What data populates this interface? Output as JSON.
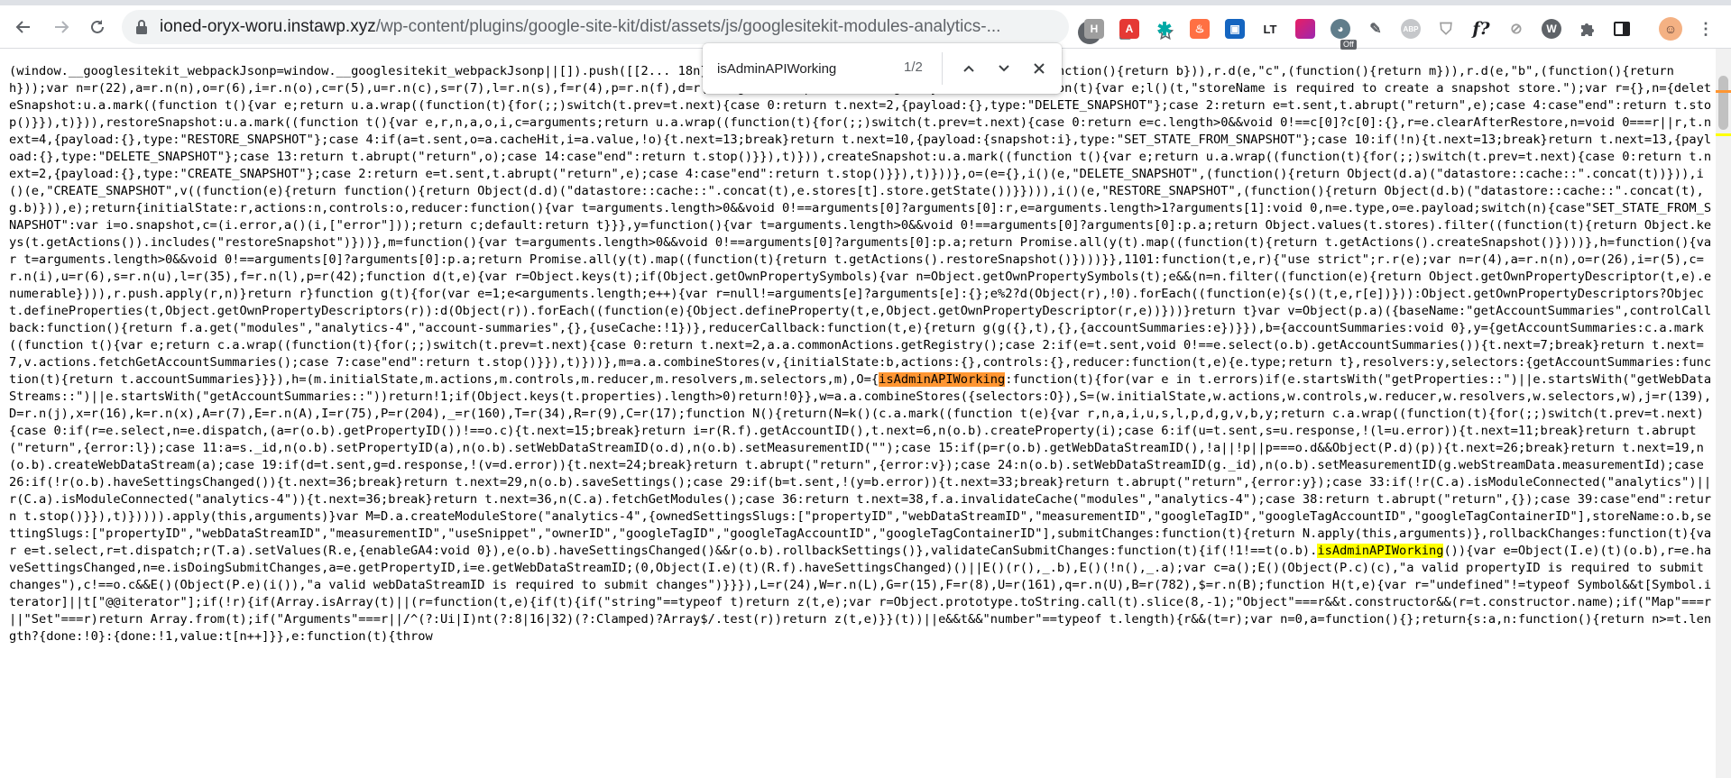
{
  "browser": {
    "url_host": "ioned-oryx-woru.instawp.xyz",
    "url_path": "/wp-content/plugins/google-site-kit/dist/assets/js/googlesitekit-modules-analytics-...",
    "extension_badge": "Off",
    "profile_letter": "W"
  },
  "find": {
    "query": "isAdminAPIWorking",
    "count": "1/2"
  },
  "code": {
    "part1": "(window.__googlesitekit_webpackJsonp=window.__googlesitekit_webpackJsonp||[]).push([[2... 18n},102:function(t,e,r){\"use strict\";r.d(e,\"a\",(function(){return b})),r.d(e,\"c\",(function(){return m})),r.d(e,\"b\",(function(){return h}));var n=r(22),a=r.n(n),o=r(6),i=r.n(o),c=r(5),u=r.n(c),s=r(7),l=r.n(s),f=r(4),p=r.n(f),d=r(47),g=r(8),v=p.a.createRegistryControl,b=function(t){var e;l()(t,\"storeName is required to create a snapshot store.\");var r={},n={deleteSnapshot:u.a.mark((function t(){var e;return u.a.wrap((function(t){for(;;)switch(t.prev=t.next){case 0:return t.next=2,{payload:{},type:\"DELETE_SNAPSHOT\"};case 2:return e=t.sent,t.abrupt(\"return\",e);case 4:case\"end\":return t.stop()}}),t)})),restoreSnapshot:u.a.mark((function t(){var e,r,n,a,o,i,c=arguments;return u.a.wrap((function(t){for(;;)switch(t.prev=t.next){case 0:return e=c.length>0&&void 0!==c[0]?c[0]:{},r=e.clearAfterRestore,n=void 0===r||r,t.next=4,{payload:{},type:\"RESTORE_SNAPSHOT\"};case 4:if(a=t.sent,o=a.cacheHit,i=a.value,!o){t.next=13;break}return t.next=10,{payload:{snapshot:i},type:\"SET_STATE_FROM_SNAPSHOT\"};case 10:if(!n){t.next=13;break}return t.next=13,{payload:{},type:\"DELETE_SNAPSHOT\"};case 13:return t.abrupt(\"return\",o);case 14:case\"end\":return t.stop()}}),t)})),createSnapshot:u.a.mark((function t(){var e;return u.a.wrap((function(t){for(;;)switch(t.prev=t.next){case 0:return t.next=2,{payload:{},type:\"CREATE_SNAPSHOT\"};case 2:return e=t.sent,t.abrupt(\"return\",e);case 4:case\"end\":return t.stop()}}),t)}))},o=(e={},i()(e,\"DELETE_SNAPSHOT\",(function(){return Object(d.a)(\"datastore::cache::\".concat(t))})),i()(e,\"CREATE_SNAPSHOT\",v((function(e){return function(){return Object(d.d)(\"datastore::cache::\".concat(t),e.stores[t].store.getState())}}))),i()(e,\"RESTORE_SNAPSHOT\",(function(){return Object(d.b)(\"datastore::cache::\".concat(t),g.b)})),e);return{initialState:r,actions:n,controls:o,reducer:function(){var t=arguments.length>0&&void 0!==arguments[0]?arguments[0]:r,e=arguments.length>1?arguments[1]:void 0,n=e.type,o=e.payload;switch(n){case\"SET_STATE_FROM_SNAPSHOT\":var i=o.snapshot,c=(i.error,a()(i,[\"error\"]));return c;default:return t}}},y=function(){var t=arguments.length>0&&void 0!==arguments[0]?arguments[0]:p.a;return Object.values(t.stores).filter((function(t){return Object.keys(t.getActions()).includes(\"restoreSnapshot\")}))},m=function(){var t=arguments.length>0&&void 0!==arguments[0]?arguments[0]:p.a;return Promise.all(y(t).map((function(t){return t.getActions().createSnapshot()})))},h=function(){var t=arguments.length>0&&void 0!==arguments[0]?arguments[0]:p.a;return Promise.all(y(t).map((function(t){return t.getActions().restoreSnapshot()})))}},1101:function(t,e,r){\"use strict\";r.r(e);var n=r(4),a=r.n(n),o=r(26),i=r(5),c=r.n(i),u=r(6),s=r.n(u),l=r(35),f=r.n(l),p=r(42);function d(t,e){var r=Object.keys(t);if(Object.getOwnPropertySymbols){var n=Object.getOwnPropertySymbols(t);e&&(n=n.filter((function(e){return Object.getOwnPropertyDescriptor(t,e).enumerable}))),r.push.apply(r,n)}return r}function g(t){for(var e=1;e<arguments.length;e++){var r=null!=arguments[e]?arguments[e]:{};e%2?d(Object(r),!0).forEach((function(e){s()(t,e,r[e])})):Object.getOwnPropertyDescriptors?Object.defineProperties(t,Object.getOwnPropertyDescriptors(r)):d(Object(r)).forEach((function(e){Object.defineProperty(t,e,Object.getOwnPropertyDescriptor(r,e))}))}return t}var v=Object(p.a)({baseName:\"getAccountSummaries\",controlCallback:function(){return f.a.get(\"modules\",\"analytics-4\",\"account-summaries\",{},{useCache:!1})},reducerCallback:function(t,e){return g(g({},t),{},{accountSummaries:e})}}),b={accountSummaries:void 0},y={getAccountSummaries:c.a.mark((function t(){var e;return c.a.wrap((function(t){for(;;)switch(t.prev=t.next){case 0:return t.next=2,a.a.commonActions.getRegistry();case 2:if(e=t.sent,void 0!==e.select(o.b).getAccountSummaries()){t.next=7;break}return t.next=7,v.actions.fetchGetAccountSummaries();case 7:case\"end\":return t.stop()}}),t)}))},m=a.a.combineStores(v,{initialState:b,actions:{},controls:{},reducer:function(t,e){e.type;return t},resolvers:y,selectors:{getAccountSummaries:function(t){return t.accountSummaries}}}),h=(m.initialState,m.actions,m.controls,m.reducer,m.resolvers,m.selectors,m),O={",
    "match1": "isAdminAPIWorking",
    "part2": ":function(t){for(var e in t.errors)if(e.startsWith(\"getProperties::\")||e.startsWith(\"getWebDataStreams::\")||e.startsWith(\"getAccountSummaries::\"))return!1;if(Object.keys(t.properties).length>0)return!0}},w=a.a.combineStores({selectors:O}),S=(w.initialState,w.actions,w.controls,w.reducer,w.resolvers,w.selectors,w),j=r(139),D=r.n(j),x=r(16),k=r.n(x),A=r(7),E=r.n(A),I=r(75),P=r(204),_=r(160),T=r(34),R=r(9),C=r(17);function N(){return(N=k()(c.a.mark((function t(e){var r,n,a,i,u,s,l,p,d,g,v,b,y;return c.a.wrap((function(t){for(;;)switch(t.prev=t.next){case 0:if(r=e.select,n=e.dispatch,(a=r(o.b).getPropertyID())!==o.c){t.next=15;break}return i=r(R.f).getAccountID(),t.next=6,n(o.b).createProperty(i);case 6:if(u=t.sent,s=u.response,!(l=u.error)){t.next=11;break}return t.abrupt(\"return\",{error:l});case 11:a=s._id,n(o.b).setPropertyID(a),n(o.b).setWebDataStreamID(o.d),n(o.b).setMeasurementID(\"\");case 15:if(p=r(o.b).getWebDataStreamID(),!a||!p||p===o.d&&Object(P.d)(p)){t.next=26;break}return t.next=19,n(o.b).createWebDataStream(a);case 19:if(d=t.sent,g=d.response,!(v=d.error)){t.next=24;break}return t.abrupt(\"return\",{error:v});case 24:n(o.b).setWebDataStreamID(g._id),n(o.b).setMeasurementID(g.webStreamData.measurementId);case 26:if(!r(o.b).haveSettingsChanged()){t.next=36;break}return t.next=29,n(o.b).saveSettings();case 29:if(b=t.sent,!(y=b.error)){t.next=33;break}return t.abrupt(\"return\",{error:y});case 33:if(!r(C.a).isModuleConnected(\"analytics\")||r(C.a).isModuleConnected(\"analytics-4\")){t.next=36;break}return t.next=36,n(C.a).fetchGetModules();case 36:return t.next=38,f.a.invalidateCache(\"modules\",\"analytics-4\");case 38:return t.abrupt(\"return\",{});case 39:case\"end\":return t.stop()}}),t)})))).apply(this,arguments)}var M=D.a.createModuleStore(\"analytics-4\",{ownedSettingsSlugs:[\"propertyID\",\"webDataStreamID\",\"measurementID\",\"googleTagID\",\"googleTagAccountID\",\"googleTagContainerID\"],storeName:o.b,settingSlugs:[\"propertyID\",\"webDataStreamID\",\"measurementID\",\"useSnippet\",\"ownerID\",\"googleTagID\",\"googleTagAccountID\",\"googleTagContainerID\"],submitChanges:function(t){return N.apply(this,arguments)},rollbackChanges:function(t){var e=t.select,r=t.dispatch;r(T.a).setValues(R.e,{enableGA4:void 0}),e(o.b).haveSettingsChanged()&&r(o.b).rollbackSettings()},validateCanSubmitChanges:function(t){if(!1!==t(o.b).",
    "match2": "isAdminAPIWorking",
    "part3": "()){var e=Object(I.e)(t)(o.b),r=e.haveSettingsChanged,n=e.isDoingSubmitChanges,a=e.getPropertyID,i=e.getWebDataStreamID;(0,Object(I.e)(t)(R.f).haveSettingsChanged)()||E()(r(),_.b),E()(!n(),_.a);var c=a();E()(Object(P.c)(c),\"a valid propertyID is required to submit changes\"),c!==o.c&&E()(Object(P.e)(i()),\"a valid webDataStreamID is required to submit changes\")}}}),L=r(24),W=r.n(L),G=r(15),F=r(8),U=r(161),q=r.n(U),B=r(782),$=r.n(B);function H(t,e){var r=\"undefined\"!=typeof Symbol&&t[Symbol.iterator]||t[\"@@iterator\"];if(!r){if(Array.isArray(t)||(r=function(t,e){if(t){if(\"string\"==typeof t)return z(t,e);var r=Object.prototype.toString.call(t).slice(8,-1);\"Object\"===r&&t.constructor&&(r=t.constructor.name);if(\"Map\"===r||\"Set\"===r)return Array.from(t);if(\"Arguments\"===r||/^(?:Ui|I)nt(?:8|16|32)(?:Clamped)?Array$/.test(r))return z(t,e)}}(t))||e&&t&&\"number\"==typeof t.length){r&&(t=r);var n=0,a=function(){};return{s:a,n:function(){return n>=t.length?{done:!0}:{done:!1,value:t[n++]}},e:function(t){throw"
  },
  "colors": {
    "current_match": "#ff9632",
    "other_match": "#ffff00"
  }
}
